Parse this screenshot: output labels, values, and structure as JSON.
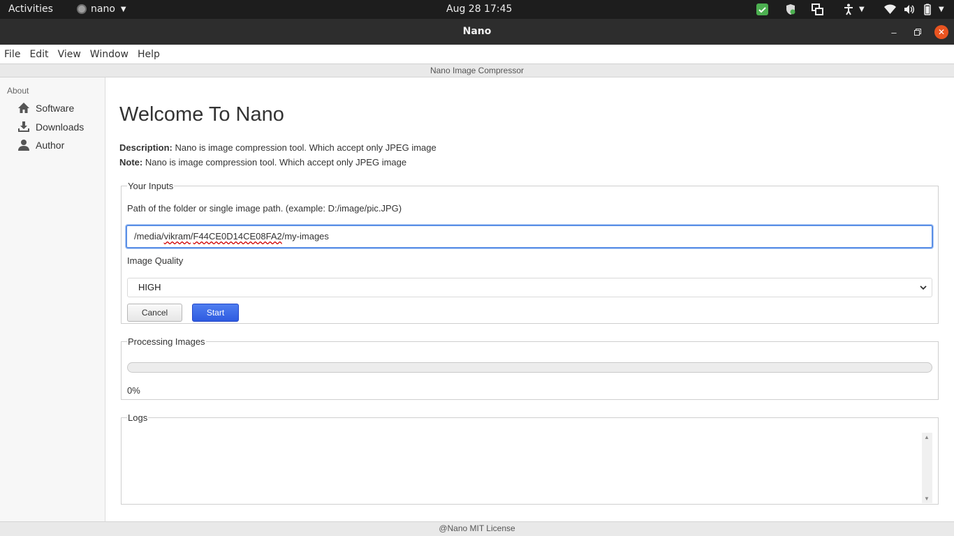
{
  "topbar": {
    "activities": "Activities",
    "app_name": "nano",
    "clock": "Aug 28  17:45"
  },
  "window": {
    "title": "Nano"
  },
  "menu": {
    "items": [
      "File",
      "Edit",
      "View",
      "Window",
      "Help"
    ]
  },
  "app_header": "Nano Image Compressor",
  "sidebar": {
    "section": "About",
    "items": [
      {
        "label": "Software",
        "icon": "home-icon"
      },
      {
        "label": "Downloads",
        "icon": "download-icon"
      },
      {
        "label": "Author",
        "icon": "user-icon"
      }
    ]
  },
  "main": {
    "title": "Welcome To Nano",
    "description_label": "Description:",
    "description_text": " Nano is image compression tool. Which accept only JPEG image",
    "note_label": "Note:",
    "note_text": " Nano is image compression tool. Which accept only JPEG image",
    "inputs": {
      "legend": "Your Inputs",
      "path_label": "Path of the folder or single image path. (example: D:/image/pic.JPG)",
      "path_value": {
        "p1": "/media/",
        "p2": "vikram",
        "p3": "/",
        "p4": "F44CE0D14CE08FA2",
        "p5": "/my-images"
      },
      "quality_label": "Image Quality",
      "quality_value": "HIGH",
      "cancel_label": "Cancel",
      "start_label": "Start"
    },
    "processing": {
      "legend": "Processing Images",
      "progress": 0,
      "percent_text": "0%"
    },
    "logs": {
      "legend": "Logs"
    }
  },
  "footer": "@Nano MIT License",
  "colors": {
    "accent": "#3d6ee6",
    "close_button": "#e95420",
    "topbar_bg": "#1d1d1d",
    "titlebar_bg": "#2d2d2d"
  }
}
